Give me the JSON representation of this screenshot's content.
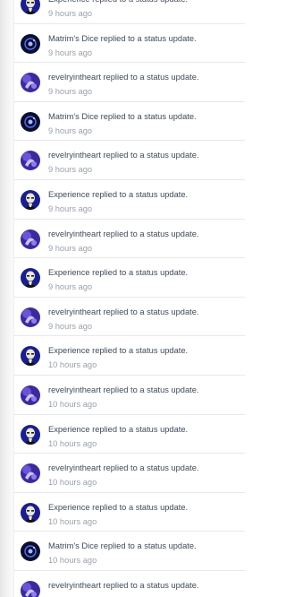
{
  "notifications": [
    {
      "user": "Experience",
      "action": "replied to a status update.",
      "time": "9 hours ago",
      "avatar": "experience-avatar"
    },
    {
      "user": "Matrim's Dice",
      "action": "replied to a status update.",
      "time": "9 hours ago",
      "avatar": "matrims-dice-avatar"
    },
    {
      "user": "revelryintheart",
      "action": "replied to a status update.",
      "time": "9 hours ago",
      "avatar": "revelryintheart-avatar"
    },
    {
      "user": "Matrim's Dice",
      "action": "replied to a status update.",
      "time": "9 hours ago",
      "avatar": "matrims-dice-avatar"
    },
    {
      "user": "revelryintheart",
      "action": "replied to a status update.",
      "time": "9 hours ago",
      "avatar": "revelryintheart-avatar"
    },
    {
      "user": "Experience",
      "action": "replied to a status update.",
      "time": "9 hours ago",
      "avatar": "experience-avatar"
    },
    {
      "user": "revelryintheart",
      "action": "replied to a status update.",
      "time": "9 hours ago",
      "avatar": "revelryintheart-avatar"
    },
    {
      "user": "Experience",
      "action": "replied to a status update.",
      "time": "9 hours ago",
      "avatar": "experience-avatar"
    },
    {
      "user": "revelryintheart",
      "action": "replied to a status update.",
      "time": "9 hours ago",
      "avatar": "revelryintheart-avatar"
    },
    {
      "user": "Experience",
      "action": "replied to a status update.",
      "time": "10 hours ago",
      "avatar": "experience-avatar"
    },
    {
      "user": "revelryintheart",
      "action": "replied to a status update.",
      "time": "10 hours ago",
      "avatar": "revelryintheart-avatar"
    },
    {
      "user": "Experience",
      "action": "replied to a status update.",
      "time": "10 hours ago",
      "avatar": "experience-avatar"
    },
    {
      "user": "revelryintheart",
      "action": "replied to a status update.",
      "time": "10 hours ago",
      "avatar": "revelryintheart-avatar"
    },
    {
      "user": "Experience",
      "action": "replied to a status update.",
      "time": "10 hours ago",
      "avatar": "experience-avatar"
    },
    {
      "user": "Matrim's Dice",
      "action": "replied to a status update.",
      "time": "10 hours ago",
      "avatar": "matrims-dice-avatar"
    },
    {
      "user": "revelryintheart",
      "action": "replied to a status update.",
      "time": "",
      "avatar": "revelryintheart-avatar"
    }
  ],
  "colors": {
    "text": "#3f4a59",
    "time": "#9aa1ab",
    "divider": "#e9e9e9",
    "experience_bg": "#1b1f8a",
    "dice_bg": "#0a0f2e",
    "revelry_bg": "#3b2a9e"
  }
}
